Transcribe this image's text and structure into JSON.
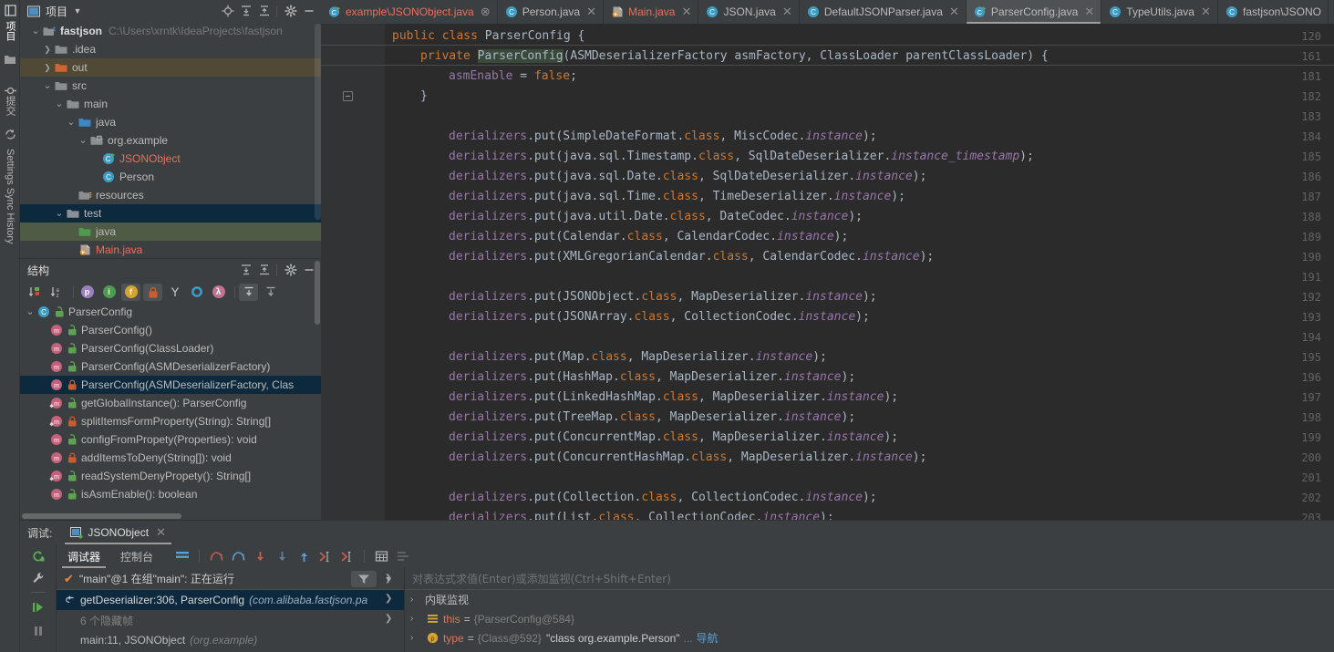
{
  "left_strip": {
    "items": [
      {
        "label": "项目",
        "icon": "project-icon",
        "active": true
      },
      {
        "label": "提交",
        "icon": "commit-icon",
        "active": false
      },
      {
        "label": "Settings Sync History",
        "icon": "sync-icon",
        "active": false
      }
    ]
  },
  "project_panel": {
    "title": "项目",
    "dropdown": "chevron-down-icon",
    "toolbar": [
      "locate-icon",
      "expand-all-icon",
      "collapse-all-icon",
      "gear-icon",
      "minimize-icon"
    ],
    "tree": [
      {
        "label": "fastjson",
        "path": "C:\\Users\\xrntk\\IdeaProjects\\fastjson",
        "indent": 0,
        "arrow": "down",
        "icon": "module-folder-icon",
        "bold": true
      },
      {
        "label": ".idea",
        "path": "",
        "indent": 1,
        "arrow": "right",
        "icon": "folder-icon"
      },
      {
        "label": "out",
        "path": "",
        "indent": 1,
        "arrow": "right",
        "icon": "folder-orange-icon",
        "highlight": "brown"
      },
      {
        "label": "src",
        "path": "",
        "indent": 1,
        "arrow": "down",
        "icon": "folder-icon"
      },
      {
        "label": "main",
        "path": "",
        "indent": 2,
        "arrow": "down",
        "icon": "folder-icon"
      },
      {
        "label": "java",
        "path": "",
        "indent": 3,
        "arrow": "down",
        "icon": "folder-blue-icon"
      },
      {
        "label": "org.example",
        "path": "",
        "indent": 4,
        "arrow": "down",
        "icon": "package-icon"
      },
      {
        "label": "JSONObject",
        "path": "",
        "indent": 5,
        "arrow": "none",
        "icon": "class-run-icon",
        "color": "red"
      },
      {
        "label": "Person",
        "path": "",
        "indent": 5,
        "arrow": "none",
        "icon": "class-icon"
      },
      {
        "label": "resources",
        "path": "",
        "indent": 3,
        "arrow": "none",
        "icon": "resources-folder-icon"
      },
      {
        "label": "test",
        "path": "",
        "indent": 2,
        "arrow": "down",
        "icon": "folder-icon",
        "highlight": "blue"
      },
      {
        "label": "java",
        "path": "",
        "indent": 3,
        "arrow": "none",
        "icon": "folder-green-icon",
        "highlight": "green"
      },
      {
        "label": "Main.java",
        "path": "",
        "indent": 3,
        "arrow": "none",
        "icon": "java-run-icon",
        "color": "red"
      }
    ]
  },
  "structure_panel": {
    "title": "结构",
    "toolbar_right": [
      "expand-all-icon",
      "collapse-all-icon",
      "gear-icon",
      "minimize-icon"
    ],
    "filter_icons": [
      {
        "name": "sort-by-visibility-icon",
        "active": false
      },
      {
        "name": "sort-alphabetically-icon",
        "active": false
      },
      {
        "name": "show-properties-icon",
        "active": false
      },
      {
        "name": "show-inherited-icon",
        "active": false
      },
      {
        "name": "show-fields-icon",
        "active": true
      },
      {
        "name": "show-non-public-icon",
        "active": true
      },
      {
        "name": "show-anonymous-icon",
        "active": false
      },
      {
        "name": "show-interfaces-icon",
        "active": false
      },
      {
        "name": "show-lambdas-icon",
        "active": false
      },
      {
        "name": "autoscroll-to-source-icon",
        "active": true
      },
      {
        "name": "autoscroll-from-source-icon",
        "active": false
      }
    ],
    "members": [
      {
        "label": "ParserConfig",
        "kind": "class",
        "modifier": "public",
        "indent": 0,
        "arrow": "down"
      },
      {
        "label": "ParserConfig()",
        "kind": "method",
        "modifier": "public",
        "indent": 1
      },
      {
        "label": "ParserConfig(ClassLoader)",
        "kind": "method",
        "modifier": "public",
        "indent": 1
      },
      {
        "label": "ParserConfig(ASMDeserializerFactory)",
        "kind": "method",
        "modifier": "public",
        "indent": 1
      },
      {
        "label": "ParserConfig(ASMDeserializerFactory, Clas",
        "kind": "method",
        "modifier": "private",
        "indent": 1,
        "selected": true
      },
      {
        "label": "getGlobalInstance(): ParserConfig",
        "kind": "method-static",
        "modifier": "public",
        "indent": 1
      },
      {
        "label": "splitItemsFormProperty(String): String[]",
        "kind": "method-static",
        "modifier": "private",
        "indent": 1
      },
      {
        "label": "configFromPropety(Properties): void",
        "kind": "method",
        "modifier": "public",
        "indent": 1
      },
      {
        "label": "addItemsToDeny(String[]): void",
        "kind": "method",
        "modifier": "private",
        "indent": 1
      },
      {
        "label": "readSystemDenyPropety(): String[]",
        "kind": "method-static",
        "modifier": "public",
        "indent": 1
      },
      {
        "label": "isAsmEnable(): boolean",
        "kind": "method",
        "modifier": "public",
        "indent": 1
      }
    ]
  },
  "tabs": [
    {
      "label": "example\\JSONObject.java",
      "icon": "class-run-icon",
      "modified": true,
      "active": false,
      "close": "⊗"
    },
    {
      "label": "Person.java",
      "icon": "class-icon",
      "modified": false,
      "active": false,
      "close": "✕"
    },
    {
      "label": "Main.java",
      "icon": "java-run-icon",
      "modified": true,
      "active": false,
      "close": "✕"
    },
    {
      "label": "JSON.java",
      "icon": "class-icon",
      "modified": false,
      "active": false,
      "close": "✕"
    },
    {
      "label": "DefaultJSONParser.java",
      "icon": "class-icon",
      "modified": false,
      "active": false,
      "close": "✕"
    },
    {
      "label": "ParserConfig.java",
      "icon": "class-run-icon",
      "modified": false,
      "active": true,
      "close": "✕"
    },
    {
      "label": "TypeUtils.java",
      "icon": "class-icon",
      "modified": false,
      "active": false,
      "close": "✕"
    },
    {
      "label": "fastjson\\JSONO",
      "icon": "class-icon",
      "modified": false,
      "active": false,
      "close": ""
    }
  ],
  "editor": {
    "lines": [
      {
        "num": "120",
        "tokens": [
          {
            "t": "public ",
            "c": "kw"
          },
          {
            "t": "class ",
            "c": "kw"
          },
          {
            "t": "ParserConfig {",
            "c": "ident"
          }
        ]
      },
      {
        "num": "161",
        "separator_above": true,
        "indent": 1,
        "tokens": [
          {
            "t": "private ",
            "c": "kw"
          },
          {
            "t": "ParserConfig",
            "c": "hl-ident"
          },
          {
            "t": "(ASMDeserializerFactory asmFactory, ClassLoader parentClassLoader) {",
            "c": "ident"
          }
        ]
      },
      {
        "num": "181",
        "separator_above": true,
        "indent": 2,
        "tokens": [
          {
            "t": "asmEnable ",
            "c": "fld"
          },
          {
            "t": "= ",
            "c": "punc"
          },
          {
            "t": "false",
            "c": "kw"
          },
          {
            "t": ";",
            "c": "punc"
          }
        ]
      },
      {
        "num": "182",
        "indent": 1,
        "fold": true,
        "tokens": [
          {
            "t": "}",
            "c": "ident"
          }
        ]
      },
      {
        "num": "183",
        "tokens": []
      },
      {
        "num": "184",
        "indent": 2,
        "tokens": [
          {
            "t": "derializers",
            "c": "fld"
          },
          {
            "t": ".put(SimpleDateFormat.",
            "c": "ident"
          },
          {
            "t": "class",
            "c": "kw"
          },
          {
            "t": ", MiscCodec.",
            "c": "ident"
          },
          {
            "t": "instance",
            "c": "stat"
          },
          {
            "t": ");",
            "c": "ident"
          }
        ]
      },
      {
        "num": "185",
        "indent": 2,
        "tokens": [
          {
            "t": "derializers",
            "c": "fld"
          },
          {
            "t": ".put(java.sql.Timestamp.",
            "c": "ident"
          },
          {
            "t": "class",
            "c": "kw"
          },
          {
            "t": ", SqlDateDeserializer.",
            "c": "ident"
          },
          {
            "t": "instance_timestamp",
            "c": "stat"
          },
          {
            "t": ");",
            "c": "ident"
          }
        ]
      },
      {
        "num": "186",
        "indent": 2,
        "tokens": [
          {
            "t": "derializers",
            "c": "fld"
          },
          {
            "t": ".put(java.sql.Date.",
            "c": "ident"
          },
          {
            "t": "class",
            "c": "kw"
          },
          {
            "t": ", SqlDateDeserializer.",
            "c": "ident"
          },
          {
            "t": "instance",
            "c": "stat"
          },
          {
            "t": ");",
            "c": "ident"
          }
        ]
      },
      {
        "num": "187",
        "indent": 2,
        "tokens": [
          {
            "t": "derializers",
            "c": "fld"
          },
          {
            "t": ".put(java.sql.Time.",
            "c": "ident"
          },
          {
            "t": "class",
            "c": "kw"
          },
          {
            "t": ", TimeDeserializer.",
            "c": "ident"
          },
          {
            "t": "instance",
            "c": "stat"
          },
          {
            "t": ");",
            "c": "ident"
          }
        ]
      },
      {
        "num": "188",
        "indent": 2,
        "tokens": [
          {
            "t": "derializers",
            "c": "fld"
          },
          {
            "t": ".put(java.util.Date.",
            "c": "ident"
          },
          {
            "t": "class",
            "c": "kw"
          },
          {
            "t": ", DateCodec.",
            "c": "ident"
          },
          {
            "t": "instance",
            "c": "stat"
          },
          {
            "t": ");",
            "c": "ident"
          }
        ]
      },
      {
        "num": "189",
        "indent": 2,
        "tokens": [
          {
            "t": "derializers",
            "c": "fld"
          },
          {
            "t": ".put(Calendar.",
            "c": "ident"
          },
          {
            "t": "class",
            "c": "kw"
          },
          {
            "t": ", CalendarCodec.",
            "c": "ident"
          },
          {
            "t": "instance",
            "c": "stat"
          },
          {
            "t": ");",
            "c": "ident"
          }
        ]
      },
      {
        "num": "190",
        "indent": 2,
        "tokens": [
          {
            "t": "derializers",
            "c": "fld"
          },
          {
            "t": ".put(XMLGregorianCalendar.",
            "c": "ident"
          },
          {
            "t": "class",
            "c": "kw"
          },
          {
            "t": ", CalendarCodec.",
            "c": "ident"
          },
          {
            "t": "instance",
            "c": "stat"
          },
          {
            "t": ");",
            "c": "ident"
          }
        ]
      },
      {
        "num": "191",
        "tokens": []
      },
      {
        "num": "192",
        "indent": 2,
        "tokens": [
          {
            "t": "derializers",
            "c": "fld"
          },
          {
            "t": ".put(JSONObject.",
            "c": "ident"
          },
          {
            "t": "class",
            "c": "kw"
          },
          {
            "t": ", MapDeserializer.",
            "c": "ident"
          },
          {
            "t": "instance",
            "c": "stat"
          },
          {
            "t": ");",
            "c": "ident"
          }
        ]
      },
      {
        "num": "193",
        "indent": 2,
        "tokens": [
          {
            "t": "derializers",
            "c": "fld"
          },
          {
            "t": ".put(JSONArray.",
            "c": "ident"
          },
          {
            "t": "class",
            "c": "kw"
          },
          {
            "t": ", CollectionCodec.",
            "c": "ident"
          },
          {
            "t": "instance",
            "c": "stat"
          },
          {
            "t": ");",
            "c": "ident"
          }
        ]
      },
      {
        "num": "194",
        "tokens": []
      },
      {
        "num": "195",
        "indent": 2,
        "tokens": [
          {
            "t": "derializers",
            "c": "fld"
          },
          {
            "t": ".put(Map.",
            "c": "ident"
          },
          {
            "t": "class",
            "c": "kw"
          },
          {
            "t": ", MapDeserializer.",
            "c": "ident"
          },
          {
            "t": "instance",
            "c": "stat"
          },
          {
            "t": ");",
            "c": "ident"
          }
        ]
      },
      {
        "num": "196",
        "indent": 2,
        "tokens": [
          {
            "t": "derializers",
            "c": "fld"
          },
          {
            "t": ".put(HashMap.",
            "c": "ident"
          },
          {
            "t": "class",
            "c": "kw"
          },
          {
            "t": ", MapDeserializer.",
            "c": "ident"
          },
          {
            "t": "instance",
            "c": "stat"
          },
          {
            "t": ");",
            "c": "ident"
          }
        ]
      },
      {
        "num": "197",
        "indent": 2,
        "tokens": [
          {
            "t": "derializers",
            "c": "fld"
          },
          {
            "t": ".put(LinkedHashMap.",
            "c": "ident"
          },
          {
            "t": "class",
            "c": "kw"
          },
          {
            "t": ", MapDeserializer.",
            "c": "ident"
          },
          {
            "t": "instance",
            "c": "stat"
          },
          {
            "t": ");",
            "c": "ident"
          }
        ]
      },
      {
        "num": "198",
        "indent": 2,
        "tokens": [
          {
            "t": "derializers",
            "c": "fld"
          },
          {
            "t": ".put(TreeMap.",
            "c": "ident"
          },
          {
            "t": "class",
            "c": "kw"
          },
          {
            "t": ", MapDeserializer.",
            "c": "ident"
          },
          {
            "t": "instance",
            "c": "stat"
          },
          {
            "t": ");",
            "c": "ident"
          }
        ]
      },
      {
        "num": "199",
        "indent": 2,
        "tokens": [
          {
            "t": "derializers",
            "c": "fld"
          },
          {
            "t": ".put(ConcurrentMap.",
            "c": "ident"
          },
          {
            "t": "class",
            "c": "kw"
          },
          {
            "t": ", MapDeserializer.",
            "c": "ident"
          },
          {
            "t": "instance",
            "c": "stat"
          },
          {
            "t": ");",
            "c": "ident"
          }
        ]
      },
      {
        "num": "200",
        "indent": 2,
        "tokens": [
          {
            "t": "derializers",
            "c": "fld"
          },
          {
            "t": ".put(ConcurrentHashMap.",
            "c": "ident"
          },
          {
            "t": "class",
            "c": "kw"
          },
          {
            "t": ", MapDeserializer.",
            "c": "ident"
          },
          {
            "t": "instance",
            "c": "stat"
          },
          {
            "t": ");",
            "c": "ident"
          }
        ]
      },
      {
        "num": "201",
        "tokens": []
      },
      {
        "num": "202",
        "indent": 2,
        "tokens": [
          {
            "t": "derializers",
            "c": "fld"
          },
          {
            "t": ".put(Collection.",
            "c": "ident"
          },
          {
            "t": "class",
            "c": "kw"
          },
          {
            "t": ", CollectionCodec.",
            "c": "ident"
          },
          {
            "t": "instance",
            "c": "stat"
          },
          {
            "t": ");",
            "c": "ident"
          }
        ]
      },
      {
        "num": "203",
        "indent": 2,
        "tokens": [
          {
            "t": "derializers",
            "c": "fld"
          },
          {
            "t": ".put(List.",
            "c": "ident"
          },
          {
            "t": "class",
            "c": "kw"
          },
          {
            "t": ", CollectionCodec.",
            "c": "ident"
          },
          {
            "t": "instance",
            "c": "stat"
          },
          {
            "t": ");",
            "c": "ident"
          }
        ]
      }
    ]
  },
  "debug": {
    "label": "调试:",
    "session_tab": "JSONObject",
    "session_close": "✕",
    "side_buttons": [
      "rerun-icon",
      "settings-wrench-icon",
      "resume-icon",
      "pause-icon"
    ],
    "toolbar_tabs": [
      {
        "label": "调试器",
        "active": true
      },
      {
        "label": "控制台",
        "active": false
      }
    ],
    "toolbar_icons": [
      "layout-icon",
      "step-over-icon",
      "step-into-icon",
      "force-step-into-icon",
      "step-out-icon",
      "run-to-cursor-icon",
      "evaluate-icon",
      "drop-frame-icon",
      "mute-breakpoints-icon",
      "settings-icon"
    ],
    "thread_status": "\"main\"@1 在组\"main\": 正在运行",
    "filter_icon": "filter-icon",
    "filter_arrow": "chevron-down-icon",
    "frames": [
      {
        "method": "getDeserializer:306, ParserConfig",
        "package": "(com.alibaba.fastjson.pa",
        "selected": true,
        "icon": "return-arrow-icon"
      },
      {
        "method": "6 个隐藏帧",
        "package": "",
        "dim": true
      },
      {
        "method": "main:11, JSONObject",
        "package": "(org.example)"
      }
    ],
    "eval_placeholder": "对表达式求值(Enter)或添加监视(Ctrl+Shift+Enter)",
    "variables": [
      {
        "name": "内联监视",
        "icon": "none",
        "arrow": "›",
        "plain": true
      },
      {
        "name": "this",
        "icon": "field-icon",
        "arrow": "›",
        "value": "{ParserConfig@584}"
      },
      {
        "name": "type",
        "icon": "param-icon",
        "arrow": "›",
        "value": "{Class@592}",
        "string": "\"class org.example.Person\"",
        "ellipsis": "...",
        "link": "导航"
      }
    ]
  },
  "colors": {
    "accent_blue": "#0d293e",
    "accent_green": "#4f5b44",
    "accent_brown": "#4f4936",
    "keyword_orange": "#cc7832",
    "field_purple": "#9876aa",
    "modified_red": "#e8705a",
    "editor_bg": "#2b2b2b",
    "panel_bg": "#3c3f41"
  }
}
